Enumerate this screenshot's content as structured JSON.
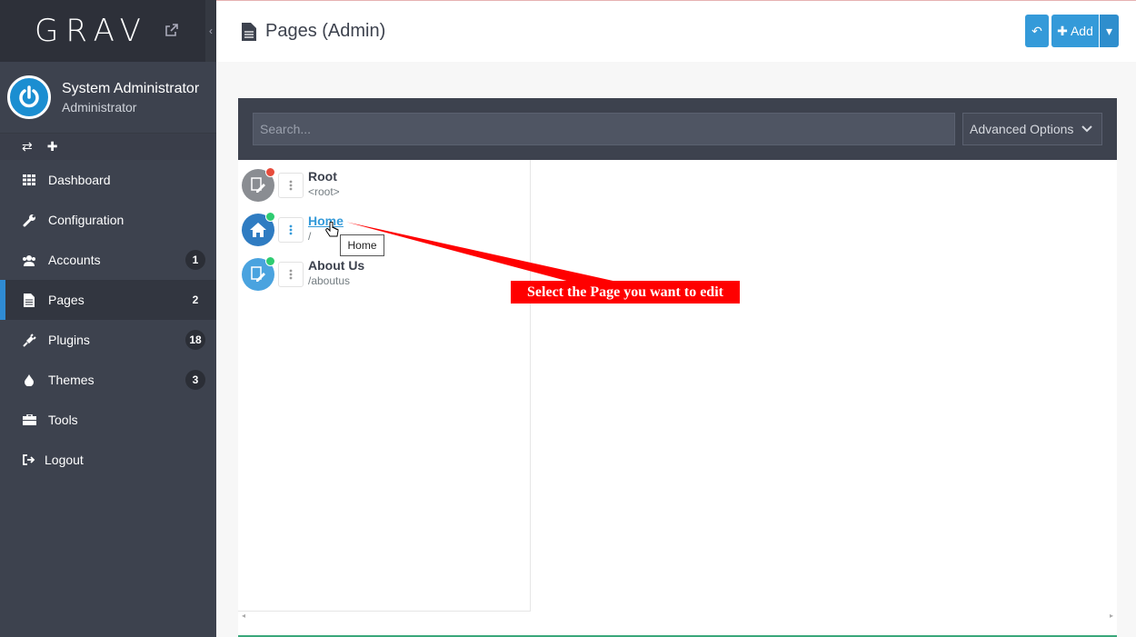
{
  "sidebar": {
    "logo": "GRAV",
    "collapse_glyph": "‹",
    "user": {
      "name": "System Administrator",
      "role": "Administrator"
    },
    "quick_actions": {
      "refresh": "⇄",
      "add": "✚"
    },
    "items": [
      {
        "label": "Dashboard",
        "icon": "grid-icon",
        "badge": ""
      },
      {
        "label": "Configuration",
        "icon": "wrench-icon",
        "badge": ""
      },
      {
        "label": "Accounts",
        "icon": "users-icon",
        "badge": "1"
      },
      {
        "label": "Pages",
        "icon": "file-icon",
        "badge": "2",
        "active": true
      },
      {
        "label": "Plugins",
        "icon": "plug-icon",
        "badge": "18"
      },
      {
        "label": "Themes",
        "icon": "tint-icon",
        "badge": "3"
      },
      {
        "label": "Tools",
        "icon": "briefcase-icon",
        "badge": ""
      },
      {
        "label": "Logout",
        "icon": "sign-out-icon",
        "badge": ""
      }
    ]
  },
  "header": {
    "title": "Pages (Admin)",
    "back_glyph": "↶",
    "add_label": "✚ Add",
    "caret_glyph": "▾"
  },
  "filters": {
    "search_placeholder": "Search...",
    "advanced_label": "Advanced Options"
  },
  "pages": [
    {
      "title": "Root",
      "route": "<root>",
      "status_color": "#e74c3c",
      "icon_color": "#8a8d92"
    },
    {
      "title": "Home",
      "route": "/",
      "status_color": "#2ecc71",
      "icon_color": "#2f7cc2"
    },
    {
      "title": "About Us",
      "route": "/aboutus",
      "status_color": "#2ecc71",
      "icon_color": "#4aa3df"
    }
  ],
  "tooltip": "Home",
  "annotation": "Select the Page you want to edit",
  "colors": {
    "accent": "#349ad9",
    "sidebar": "#3d424e",
    "annotation": "#ff0000"
  }
}
